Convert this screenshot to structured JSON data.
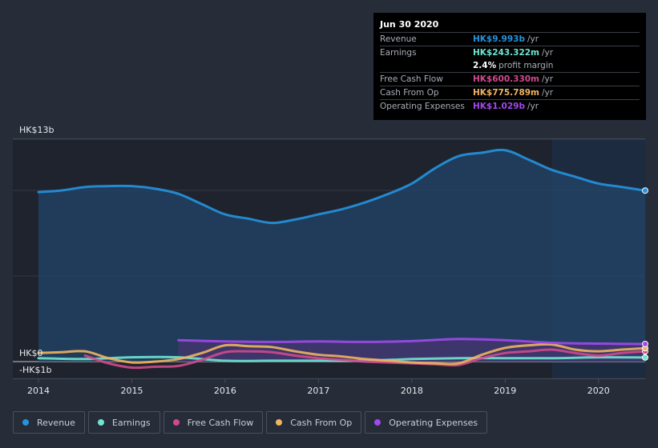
{
  "tooltip": {
    "date": "Jun 30 2020",
    "rows": [
      {
        "label": "Revenue",
        "value": "HK$9.993b",
        "unit": "/yr",
        "color": "#2394df"
      },
      {
        "label": "Earnings",
        "value": "HK$243.322m",
        "unit": "/yr",
        "color": "#6ee5d2"
      },
      {
        "label": "",
        "value": "2.4%",
        "unit": "profit margin",
        "color": "#ffffff"
      },
      {
        "label": "Free Cash Flow",
        "value": "HK$600.330m",
        "unit": "/yr",
        "color": "#d1498d"
      },
      {
        "label": "Cash From Op",
        "value": "HK$775.789m",
        "unit": "/yr",
        "color": "#f0b461"
      },
      {
        "label": "Operating Expenses",
        "value": "HK$1.029b",
        "unit": "/yr",
        "color": "#a149eb"
      }
    ]
  },
  "legend": [
    {
      "label": "Revenue",
      "color": "#2394df"
    },
    {
      "label": "Earnings",
      "color": "#6ee5d2"
    },
    {
      "label": "Free Cash Flow",
      "color": "#d1498d"
    },
    {
      "label": "Cash From Op",
      "color": "#f0b461"
    },
    {
      "label": "Operating Expenses",
      "color": "#a149eb"
    }
  ],
  "chart_data": {
    "type": "line",
    "title": "",
    "xlabel": "",
    "ylabel": "",
    "y_tick_labels": [
      "HK$13b",
      "HK$0",
      "-HK$1b"
    ],
    "x_tick_labels": [
      "2014",
      "2015",
      "2016",
      "2017",
      "2018",
      "2019",
      "2020"
    ],
    "xlim": [
      2014,
      2020.5
    ],
    "ylim": [
      -1,
      13
    ],
    "grid": true,
    "forecast_shade_start": 2019.5,
    "series": [
      {
        "name": "Revenue",
        "color": "#2394df",
        "area": true,
        "x": [
          2014,
          2014.25,
          2014.5,
          2014.75,
          2015,
          2015.25,
          2015.5,
          2015.75,
          2016,
          2016.25,
          2016.5,
          2016.75,
          2017,
          2017.25,
          2017.5,
          2017.75,
          2018,
          2018.25,
          2018.5,
          2018.75,
          2019,
          2019.25,
          2019.5,
          2019.75,
          2020,
          2020.25,
          2020.5
        ],
        "values": [
          9.9,
          10.0,
          10.2,
          10.25,
          10.25,
          10.1,
          9.8,
          9.2,
          8.6,
          8.35,
          8.1,
          8.3,
          8.6,
          8.9,
          9.3,
          9.8,
          10.4,
          11.3,
          12.0,
          12.2,
          12.35,
          11.8,
          11.2,
          10.8,
          10.4,
          10.2,
          9.99
        ]
      },
      {
        "name": "Earnings",
        "color": "#6ee5d2",
        "area": false,
        "x": [
          2014,
          2014.5,
          2015,
          2015.5,
          2016,
          2016.5,
          2017,
          2017.5,
          2018,
          2018.5,
          2019,
          2019.5,
          2020,
          2020.5
        ],
        "values": [
          0.2,
          0.15,
          0.25,
          0.25,
          0.05,
          0.05,
          0.05,
          0.05,
          0.15,
          0.2,
          0.2,
          0.2,
          0.25,
          0.24
        ]
      },
      {
        "name": "Free Cash Flow",
        "color": "#d1498d",
        "area": false,
        "x": [
          2014.5,
          2014.75,
          2015,
          2015.25,
          2015.5,
          2015.75,
          2016,
          2016.25,
          2016.5,
          2016.75,
          2017,
          2017.25,
          2017.5,
          2017.75,
          2018,
          2018.25,
          2018.5,
          2018.75,
          2019,
          2019.25,
          2019.5,
          2019.75,
          2020,
          2020.25,
          2020.5
        ],
        "values": [
          0.35,
          -0.1,
          -0.35,
          -0.3,
          -0.25,
          0.1,
          0.55,
          0.6,
          0.55,
          0.35,
          0.2,
          0.1,
          0.0,
          -0.05,
          -0.1,
          -0.15,
          -0.2,
          0.2,
          0.5,
          0.6,
          0.7,
          0.5,
          0.35,
          0.5,
          0.6
        ]
      },
      {
        "name": "Cash From Op",
        "color": "#f0b461",
        "area": false,
        "x": [
          2014,
          2014.25,
          2014.5,
          2014.75,
          2015,
          2015.25,
          2015.5,
          2015.75,
          2016,
          2016.25,
          2016.5,
          2016.75,
          2017,
          2017.25,
          2017.5,
          2017.75,
          2018,
          2018.25,
          2018.5,
          2018.75,
          2019,
          2019.25,
          2019.5,
          2019.75,
          2020,
          2020.25,
          2020.5
        ],
        "values": [
          0.5,
          0.55,
          0.6,
          0.2,
          -0.05,
          0.0,
          0.15,
          0.5,
          0.95,
          0.9,
          0.85,
          0.6,
          0.4,
          0.3,
          0.15,
          0.05,
          -0.05,
          -0.1,
          -0.1,
          0.4,
          0.8,
          0.95,
          1.0,
          0.7,
          0.6,
          0.7,
          0.78
        ]
      },
      {
        "name": "Operating Expenses",
        "color": "#a149eb",
        "area": true,
        "x": [
          2015.5,
          2016,
          2016.5,
          2017,
          2017.5,
          2018,
          2018.5,
          2019,
          2019.5,
          2020,
          2020.5
        ],
        "values": [
          1.25,
          1.18,
          1.15,
          1.18,
          1.15,
          1.2,
          1.32,
          1.25,
          1.1,
          1.05,
          1.03
        ]
      }
    ]
  }
}
